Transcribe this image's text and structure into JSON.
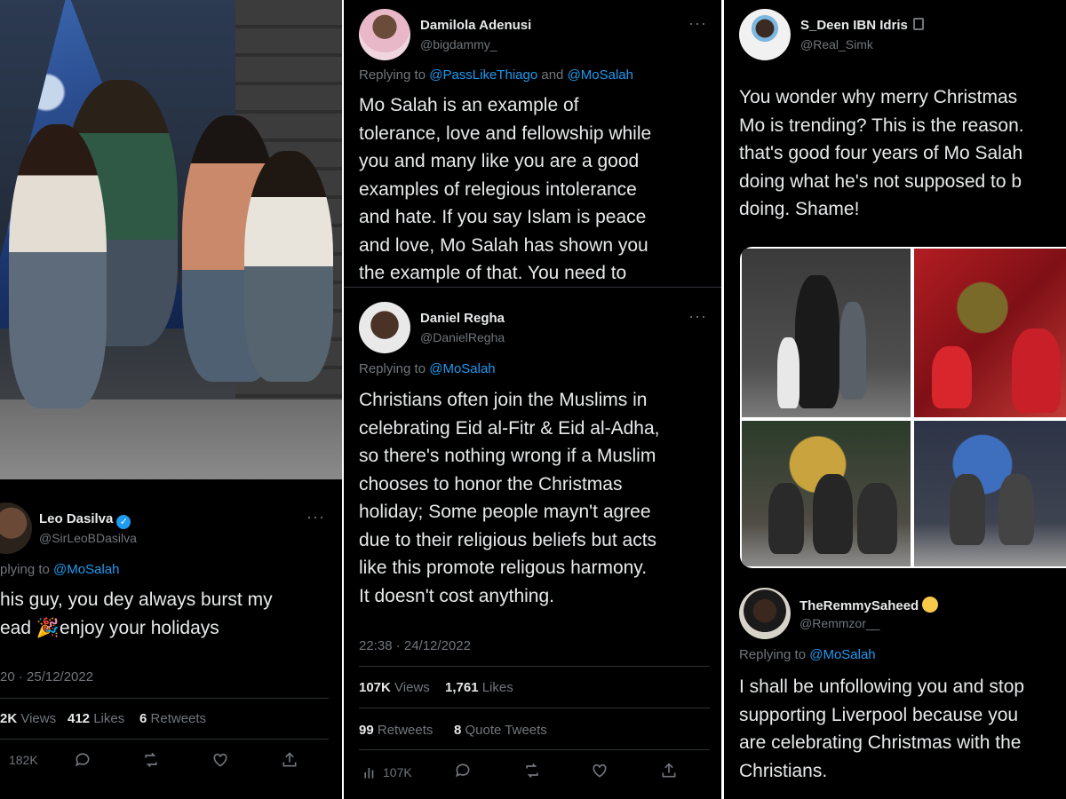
{
  "colors": {
    "background": "#000000",
    "text": "#e7e9ea",
    "muted": "#71767b",
    "link": "#1d9bf0",
    "divider": "#2f3336"
  },
  "tweet_leo": {
    "name": "Leo Dasilva",
    "handle": "@SirLeoBDasilva",
    "verified": true,
    "reply_prefix": "plying to",
    "reply_to": "@MoSalah",
    "text": "his guy, you dey always burst my\nead 🎉enjoy your holidays",
    "timestamp": "20 · 25/12/2022",
    "views_count": "2K",
    "views_label": "Views",
    "likes_count": "412",
    "likes_label": "Likes",
    "retweets_count": "6",
    "retweets_label": "Retweets",
    "action_views": "182K",
    "more_label": "···"
  },
  "tweet_damilola": {
    "name": "Damilola Adenusi",
    "handle": "@bigdammy_",
    "reply_prefix": "Replying to",
    "reply_to_1": "@PassLikeThiago",
    "reply_and": "and",
    "reply_to_2": "@MoSalah",
    "text": "Mo Salah is an example of\ntolerance, love and fellowship while\nyou and many like you are a good\nexamples of relegious intolerance\nand hate. If you say Islam is peace\nand love, Mo Salah has shown you\nthe example of that. You need to",
    "more_label": "···"
  },
  "tweet_daniel": {
    "name": "Daniel Regha",
    "handle": "@DanielRegha",
    "reply_prefix": "Replying to",
    "reply_to": "@MoSalah",
    "text": "Christians often join the Muslims in\ncelebrating Eid al-Fitr & Eid al-Adha,\nso there's nothing wrong if a Muslim\nchooses to honor the Christmas\nholiday; Some people mayn't agree\ndue to their religious beliefs but acts\nlike this promote religous harmony.\nIt doesn't cost anything.",
    "timestamp": "22:38 · 24/12/2022",
    "views_count": "107K",
    "views_label": "Views",
    "likes_count": "1,761",
    "likes_label": "Likes",
    "retweets_count": "99",
    "retweets_label": "Retweets",
    "quotes_count": "8",
    "quotes_label": "Quote Tweets",
    "action_views": "107K",
    "more_label": "···"
  },
  "tweet_sdeen": {
    "name": "S_Deen IBN Idris",
    "handle": "@Real_Simk",
    "protected": true,
    "text": "You wonder why merry Christmas\nMo is trending? This is the reason.\nthat's good four years of Mo Salah\ndoing what he's not supposed to b\ndoing. Shame!",
    "more_label": "···"
  },
  "tweet_remmy": {
    "name": "TheRemmySaheed",
    "handle": "@Remmzor__",
    "reply_prefix": "Replying to",
    "reply_to": "@MoSalah",
    "text": "I shall be unfollowing you and stop\nsupporting Liverpool because you\nare celebrating Christmas with the\nChristians."
  }
}
